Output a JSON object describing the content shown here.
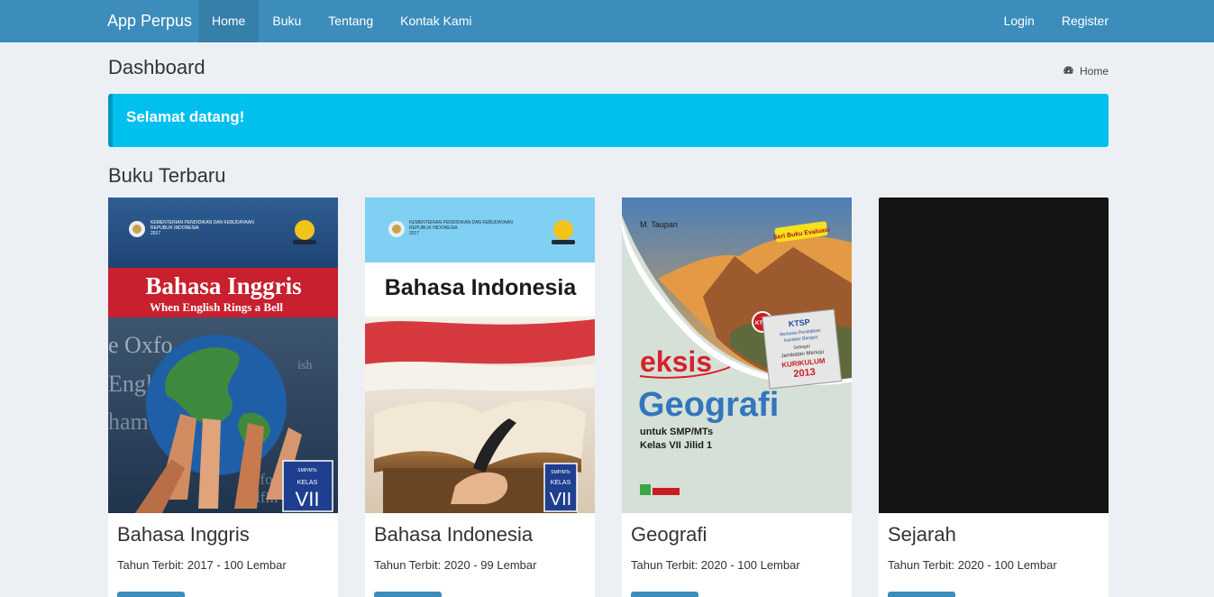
{
  "navbar": {
    "brand": "App Perpus",
    "left_links": [
      "Home",
      "Buku",
      "Tentang",
      "Kontak Kami"
    ],
    "active": "Home",
    "right_links": [
      "Login",
      "Register"
    ]
  },
  "page": {
    "title": "Dashboard",
    "breadcrumb": "Home",
    "callout": "Selamat datang!",
    "section_title": "Buku Terbaru"
  },
  "books": [
    {
      "title": "Bahasa Inggris",
      "meta": "Tahun Terbit: 2017 - 100 Lembar",
      "cover": {
        "ministry": "KEMENTERIAN PENDIDIKAN DAN KEBUDAYAAN",
        "country": "REPUBLIK INDONESIA",
        "year": "2017",
        "heading": "Bahasa Inggris",
        "subtitle": "When English Rings a Bell",
        "level": "SMP/MTs",
        "kelas": "KELAS",
        "grade": "VII"
      }
    },
    {
      "title": "Bahasa Indonesia",
      "meta": "Tahun Terbit: 2020 - 99 Lembar",
      "cover": {
        "ministry": "KEMENTERIAN PENDIDIKAN DAN KEBUDAYAAN",
        "country": "REPUBLIK INDONESIA",
        "year": "2017",
        "heading": "Bahasa Indonesia",
        "level": "SMP/MTs",
        "kelas": "KELAS",
        "grade": "VII"
      }
    },
    {
      "title": "Geografi",
      "meta": "Tahun Terbit: 2020 - 100 Lembar",
      "cover": {
        "author": "M. Taupan",
        "series": "Seri Buku Evaluasi",
        "ktsp": "KTSP",
        "ktsp_lines": [
          "Berbasis Pendidikan",
          "Karakter Bangsa",
          "Sebagai",
          "Jembatan Menuju"
        ],
        "kurikulum": "KURIKULUM",
        "kurikulum_year": "2013",
        "brand": "eksis",
        "heading": "Geografi",
        "sub1": "untuk SMP/MTs",
        "sub2": "Kelas VII Jilid 1"
      }
    },
    {
      "title": "Sejarah",
      "meta": "Tahun Terbit: 2020 - 100 Lembar",
      "cover": {}
    }
  ],
  "colors": {
    "navbar": "#3c8dbc",
    "navbar_active": "#367fa9",
    "callout": "#00c0ef",
    "background": "#ecf0f5",
    "button": "#3c8dbc"
  }
}
